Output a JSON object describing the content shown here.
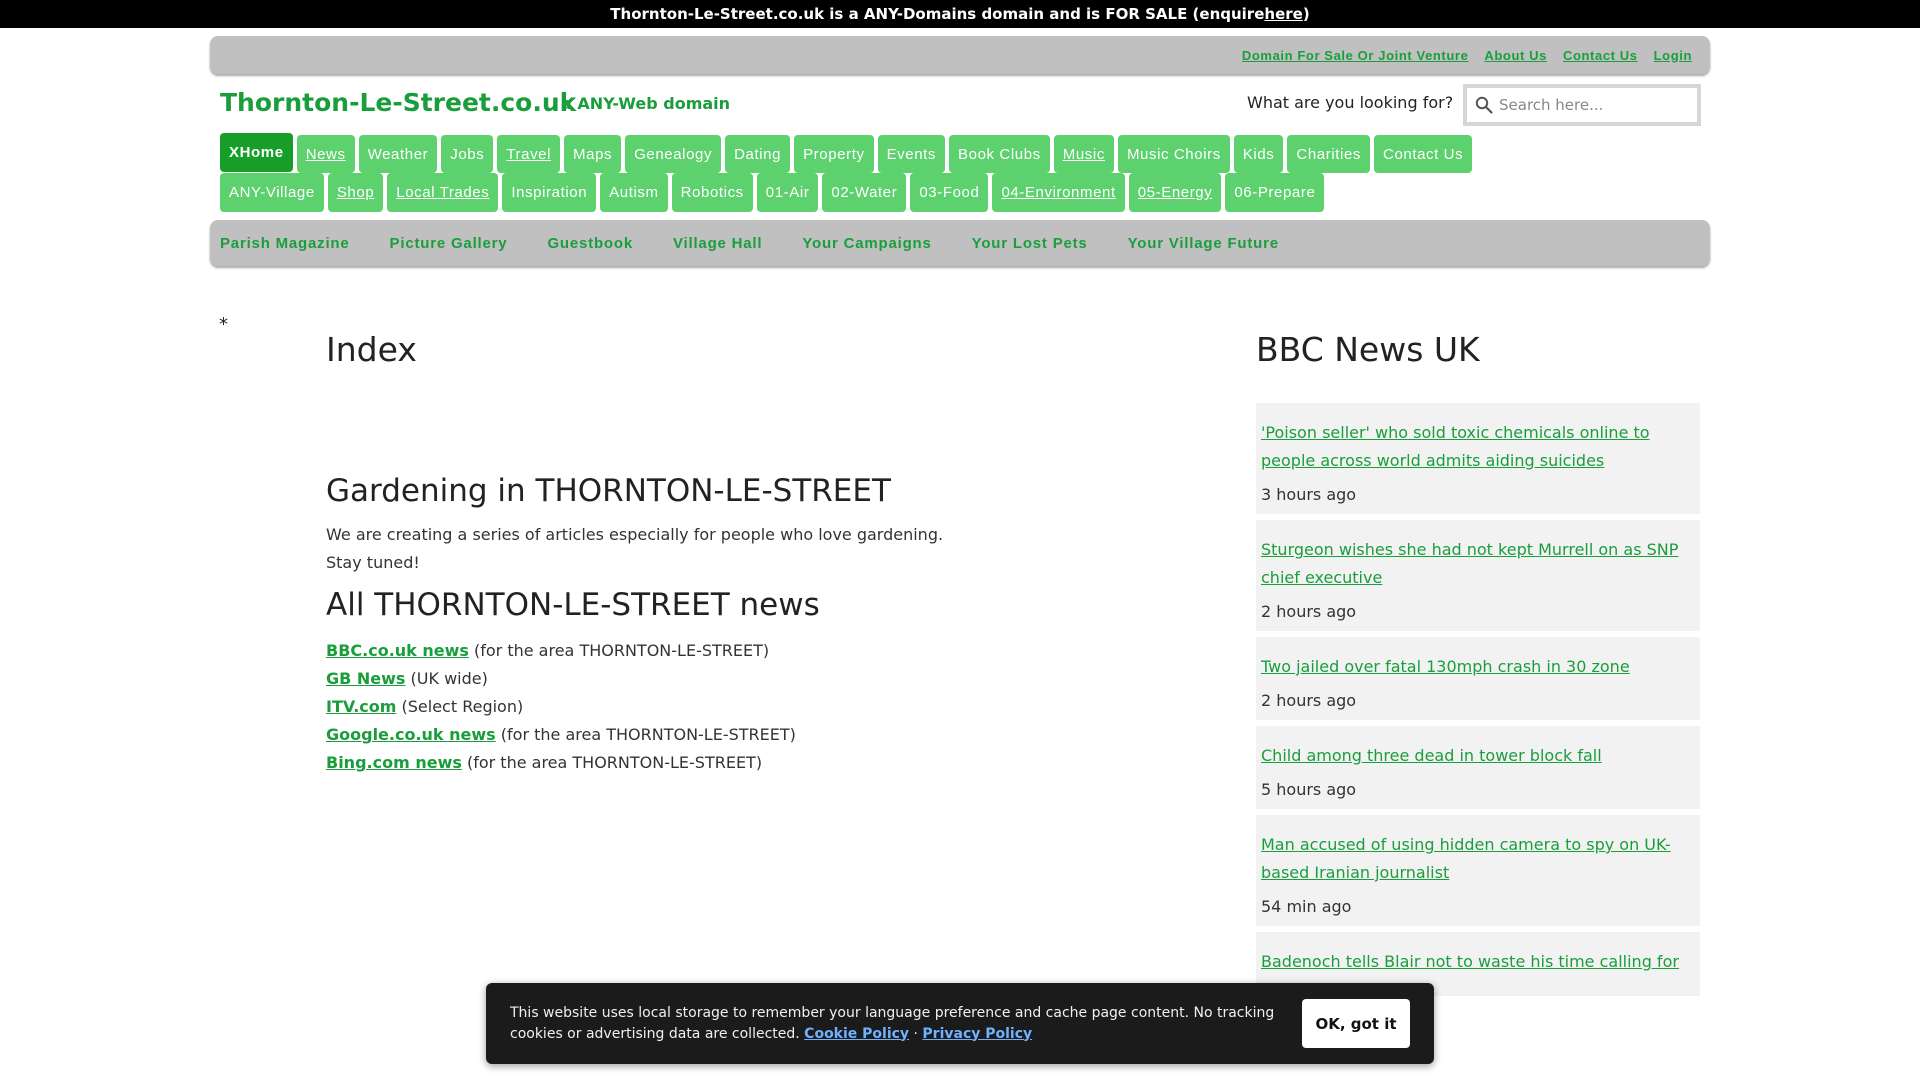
{
  "topbar": {
    "text": "Thornton-Le-Street.co.uk is a ANY-Domains domain and is FOR SALE (enquire ",
    "link": "here",
    "close": ")"
  },
  "utility_nav": [
    "Domain For Sale Or Joint Venture",
    "About Us",
    "Contact Us",
    "Login"
  ],
  "brand": {
    "name": "Thornton-Le-Street.co.uk",
    "tagline": "a ANY-Web domain"
  },
  "search": {
    "label": "What are you looking for?",
    "placeholder": "Search here..."
  },
  "nav_row1": [
    "XHome",
    "News",
    "Weather",
    "Jobs",
    "Travel",
    "Maps",
    "Genealogy",
    "Dating",
    "Property",
    "Events",
    "Book Clubs",
    "Music",
    "Music Choirs",
    "Kids",
    "Charities",
    "Contact Us"
  ],
  "nav_row2": [
    "ANY-Village",
    "Shop",
    "Local Trades",
    "Inspiration",
    "Autism",
    "Robotics",
    "01-Air",
    "02-Water",
    "03-Food",
    "04-Environment",
    "05-Energy",
    "06-Prepare"
  ],
  "secondary_nav": [
    "Parish Magazine",
    "Picture Gallery",
    "Guestbook",
    "Village Hall",
    "Your Campaigns",
    "Your Lost Pets",
    "Your Village Future"
  ],
  "asterisk": "*",
  "main": {
    "index_title": "Index",
    "gardening_title": "Gardening in THORNTON-LE-STREET",
    "gardening_text": "We are creating a series of articles especially for people who love gardening. Stay tuned!",
    "news_title": "All THORNTON-LE-STREET news",
    "news_links": [
      {
        "link": "BBC.co.uk news",
        "desc": " (for the area THORNTON-LE-STREET)"
      },
      {
        "link": "GB News",
        "desc": " (UK wide)"
      },
      {
        "link": "ITV.com",
        "desc": " (Select Region)"
      },
      {
        "link": "Google.co.uk news",
        "desc": " (for the area THORNTON-LE-STREET)"
      },
      {
        "link": "Bing.com news",
        "desc": " (for the area THORNTON-LE-STREET)"
      }
    ]
  },
  "sidebar": {
    "title": "BBC News UK",
    "items": [
      {
        "headline": "'Poison seller' who sold toxic chemicals online to people across world admits aiding suicides",
        "time": "3 hours ago"
      },
      {
        "headline": "Sturgeon wishes she had not kept Murrell on as SNP chief executive",
        "time": "2 hours ago"
      },
      {
        "headline": "Two jailed over fatal 130mph crash in 30 zone",
        "time": "2 hours ago"
      },
      {
        "headline": "Child among three dead in tower block fall",
        "time": "5 hours ago"
      },
      {
        "headline": "Man accused of using hidden camera to spy on UK-based Iranian journalist",
        "time": "54 min ago"
      },
      {
        "headline": "Badenoch tells Blair not to waste his time calling for",
        "time": ""
      }
    ]
  },
  "cookie": {
    "text": "This website uses local storage to remember your language preference and cache page content. No tracking cookies or advertising data are collected. ",
    "cookie_policy": "Cookie Policy",
    "separator": " · ",
    "privacy_policy": "Privacy Policy",
    "button": "OK, got it"
  },
  "colors": {
    "brand_green": "#1a9e3c",
    "nav_green": "#5dd16d",
    "nav_active": "#169e28",
    "bar_gray": "#c0c0c0"
  }
}
